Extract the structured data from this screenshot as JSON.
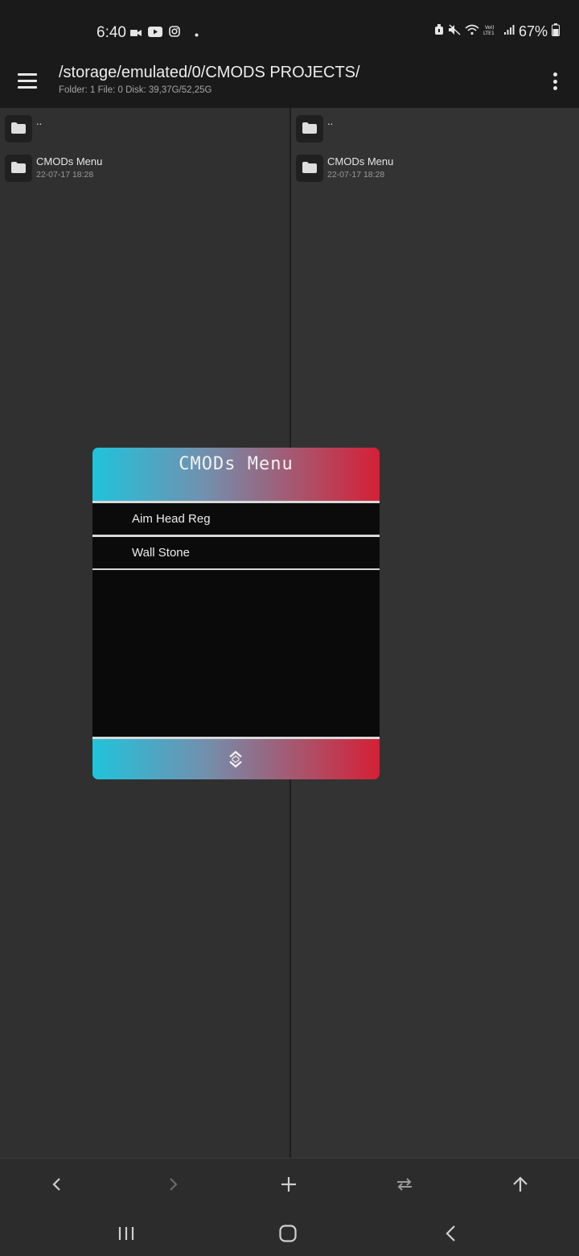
{
  "status_bar": {
    "time": "6:40",
    "battery": "67%",
    "left_icons": [
      "video-camera-icon",
      "youtube-icon",
      "instagram-icon",
      "dot-icon"
    ],
    "right_icons": [
      "alarm-icon",
      "mute-icon",
      "wifi-icon",
      "volte-icon",
      "signal-icon",
      "battery-icon"
    ]
  },
  "app_bar": {
    "path": "/storage/emulated/0/CMODS PROJECTS/",
    "subtitle": "Folder: 1  File: 0  Disk: 39,37G/52,25G",
    "menu_icon": "hamburger-icon",
    "overflow_icon": "more-vert-icon"
  },
  "left_pane": {
    "items": [
      {
        "name": "..",
        "date": ""
      },
      {
        "name": "CMODs Menu",
        "date": "22-07-17 18:28"
      }
    ]
  },
  "right_pane": {
    "items": [
      {
        "name": "..",
        "date": ""
      },
      {
        "name": "CMODs Menu",
        "date": "22-07-17 18:28"
      }
    ]
  },
  "mod_menu": {
    "title": "CMODs Menu",
    "items": [
      {
        "label": "Aim Head Reg"
      },
      {
        "label": "Wall Stone"
      }
    ],
    "footer_icon": "collapse-expand-icon",
    "gradient_start": "#20c3dc",
    "gradient_end": "#d42036"
  },
  "toolbar": {
    "buttons": [
      "back-arrow-icon",
      "forward-arrow-icon",
      "add-icon",
      "swap-icon",
      "up-arrow-icon"
    ]
  },
  "nav_bar": {
    "buttons": [
      "recents-icon",
      "home-icon",
      "back-icon"
    ]
  },
  "colors": {
    "background": "#303030",
    "bar": "#1a1a1a",
    "text": "#e6e6e6"
  }
}
